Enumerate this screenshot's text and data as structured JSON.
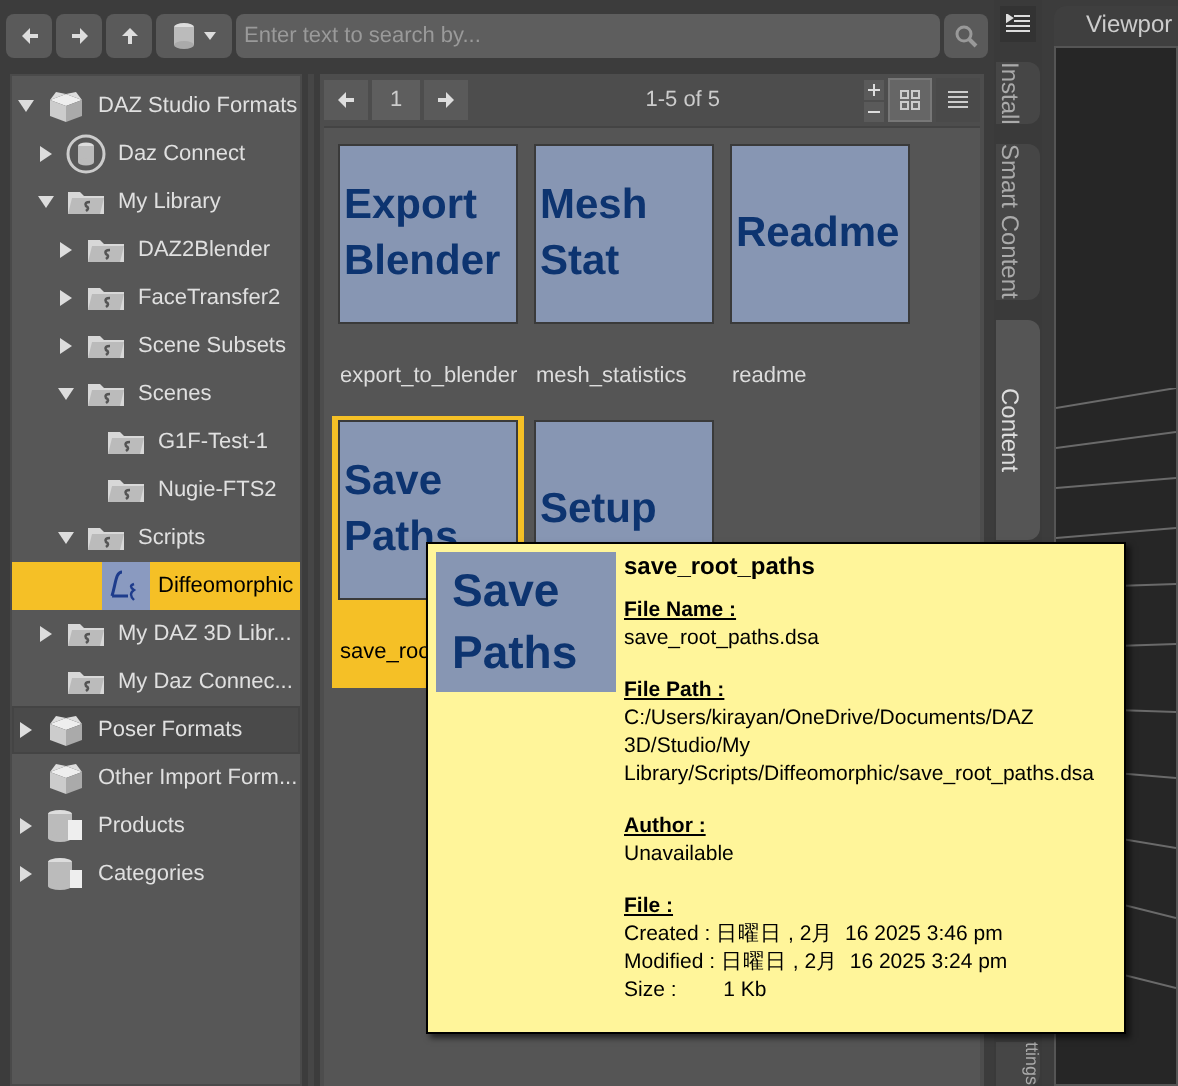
{
  "toolbar": {
    "search": {
      "placeholder": "Enter text to search by..."
    }
  },
  "tree": [
    {
      "label": "DAZ Studio Formats",
      "kind": "box",
      "expanded": true,
      "selected": false,
      "hovered": false,
      "children": [
        {
          "label": "Daz Connect",
          "kind": "database",
          "expanded": false,
          "selected": false,
          "hovered": false
        },
        {
          "label": "My Library",
          "kind": "folder",
          "expanded": true,
          "selected": false,
          "hovered": false,
          "children": [
            {
              "label": "DAZ2Blender",
              "kind": "folder",
              "expanded": false,
              "selected": false,
              "hovered": false
            },
            {
              "label": "FaceTransfer2",
              "kind": "folder",
              "expanded": false,
              "selected": false,
              "hovered": false
            },
            {
              "label": "Scene Subsets",
              "kind": "folder",
              "expanded": false,
              "selected": false,
              "hovered": false
            },
            {
              "label": "Scenes",
              "kind": "folder",
              "expanded": true,
              "selected": false,
              "hovered": false,
              "children": [
                {
                  "label": "G1F-Test-1",
                  "kind": "folder",
                  "selected": false,
                  "hovered": false
                },
                {
                  "label": "Nugie-FTS2",
                  "kind": "folder",
                  "selected": false,
                  "hovered": false
                }
              ]
            },
            {
              "label": "Scripts",
              "kind": "folder",
              "expanded": true,
              "selected": false,
              "hovered": false,
              "children": [
                {
                  "label": "Diffeomorphic",
                  "kind": "script",
                  "selected": true,
                  "hovered": false
                }
              ]
            }
          ]
        },
        {
          "label": "My DAZ 3D Libr...",
          "kind": "folder",
          "expanded": false,
          "selected": false,
          "hovered": false
        },
        {
          "label": "My Daz Connec...",
          "kind": "folder",
          "selected": false,
          "hovered": false
        }
      ]
    },
    {
      "label": "Poser Formats",
      "kind": "box",
      "expanded": false,
      "selected": false,
      "hovered": true
    },
    {
      "label": "Other Import Form...",
      "kind": "box",
      "selected": false,
      "hovered": false
    },
    {
      "label": "Products",
      "kind": "products",
      "expanded": false,
      "selected": false,
      "hovered": false
    },
    {
      "label": "Categories",
      "kind": "categories",
      "expanded": false,
      "selected": false,
      "hovered": false
    }
  ],
  "pager": {
    "page": "1",
    "range": "1-5 of 5",
    "view_buttons": [
      {
        "kind": "grid",
        "selected": true
      },
      {
        "kind": "list",
        "selected": false
      }
    ]
  },
  "items": [
    {
      "thumb_lines": [
        "Export",
        "Blender"
      ],
      "label": "export_to_blender",
      "selected": false
    },
    {
      "thumb_lines": [
        "Mesh",
        "Stat"
      ],
      "label": "mesh_statistics",
      "selected": false
    },
    {
      "thumb_lines": [
        "Readme"
      ],
      "label": "readme",
      "selected": false
    },
    {
      "thumb_lines": [
        "Save",
        "Paths"
      ],
      "label": "save_roo",
      "selected": true
    },
    {
      "thumb_lines": [
        "Setup"
      ],
      "selected": false
    }
  ],
  "side_tabs": [
    {
      "label": "Install",
      "selected": false
    },
    {
      "label": "Smart Content",
      "selected": false
    },
    {
      "label": "Content",
      "selected": true
    },
    {
      "label": "ttings",
      "selected": false
    }
  ],
  "viewport": {
    "tab": "Viewpor"
  },
  "tooltip": {
    "thumb_lines": [
      "Save",
      "Paths"
    ],
    "title": "save_root_paths",
    "sections": [
      {
        "heading": "File Name :",
        "lines": [
          "save_root_paths.dsa"
        ]
      },
      {
        "heading": "File Path :",
        "lines": [
          "C:/Users/kirayan/OneDrive/Documents/DAZ",
          "3D/Studio/My",
          "Library/Scripts/Diffeomorphic/save_root_paths.dsa"
        ]
      },
      {
        "heading": "Author :",
        "lines": [
          "Unavailable"
        ]
      },
      {
        "heading": "File :",
        "lines": [
          "Created : 日曜日 , 2月  16 2025 3:46 pm",
          "Modified : 日曜日 , 2月  16 2025 3:24 pm",
          "Size :        1 Kb"
        ]
      }
    ]
  }
}
